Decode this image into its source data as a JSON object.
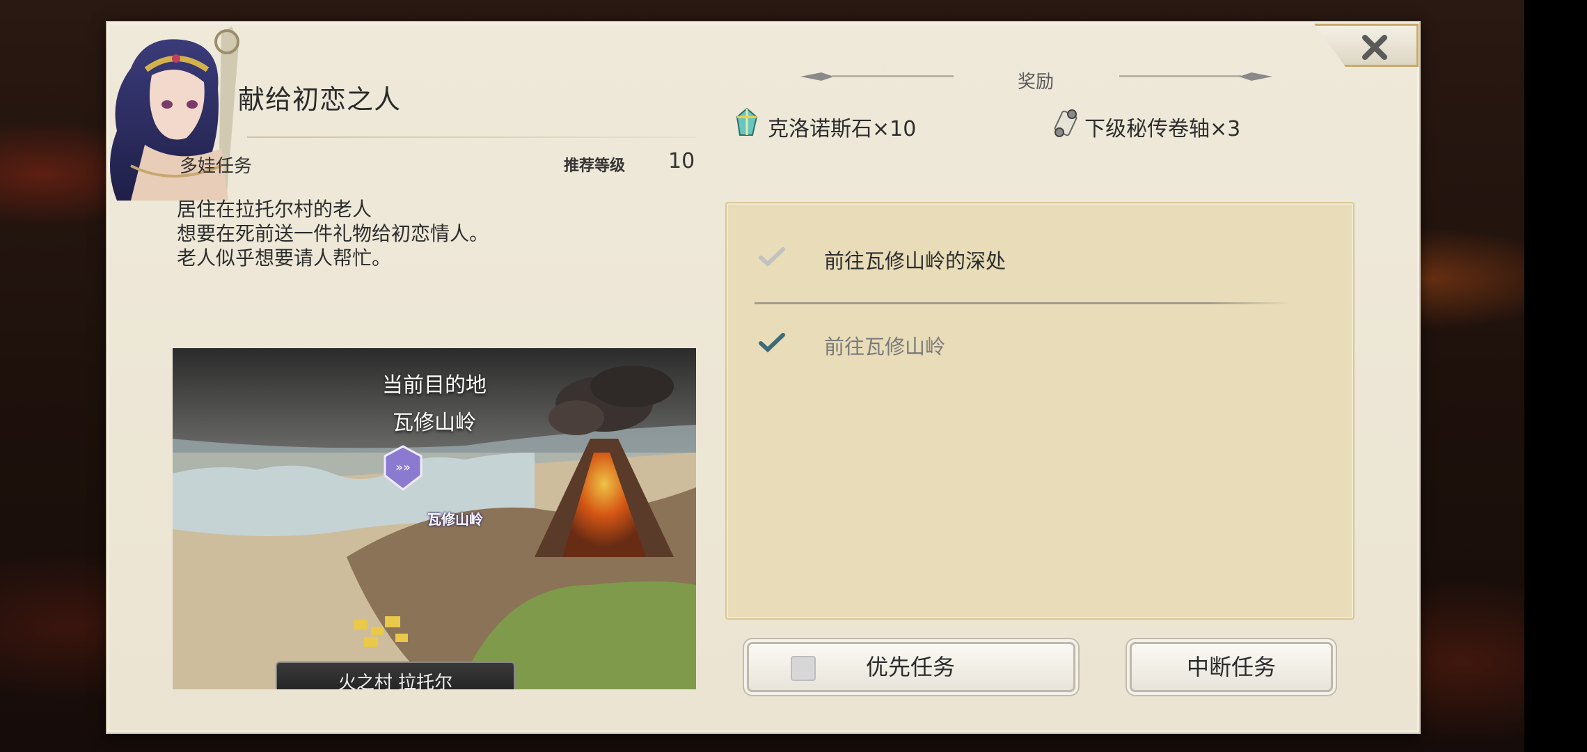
{
  "quest": {
    "title": "献给初恋之人",
    "type": "多娃任务",
    "recommended_level_label": "推荐等级",
    "recommended_level": "10",
    "description_lines": [
      "居住在拉托尔村的老人",
      "想要在死前送一件礼物给初恋情人。",
      "老人似乎想要请人帮忙。"
    ]
  },
  "map": {
    "current_destination_label": "当前目的地",
    "destination_name": "瓦修山岭",
    "marker_label": "瓦修山岭",
    "village_label": "火之村 拉托尔"
  },
  "rewards": {
    "header": "奖励",
    "items": [
      {
        "label": "克洛诺斯石×10",
        "icon": "chronos-stone-icon"
      },
      {
        "label": "下级秘传卷轴×3",
        "icon": "scroll-icon"
      }
    ]
  },
  "objectives": [
    {
      "label": "前往瓦修山岭的深处",
      "status": "current"
    },
    {
      "label": "前往瓦修山岭",
      "status": "completed"
    }
  ],
  "buttons": {
    "priority_label": "优先任务",
    "abort_label": "中断任务",
    "close": "close-icon"
  },
  "colors": {
    "panel": "#ece6d6",
    "objective_box": "#e8dcb9",
    "check_done": "#3d6b78",
    "check_pending": "#bdbdbd",
    "gold_border": "#c9a869"
  }
}
